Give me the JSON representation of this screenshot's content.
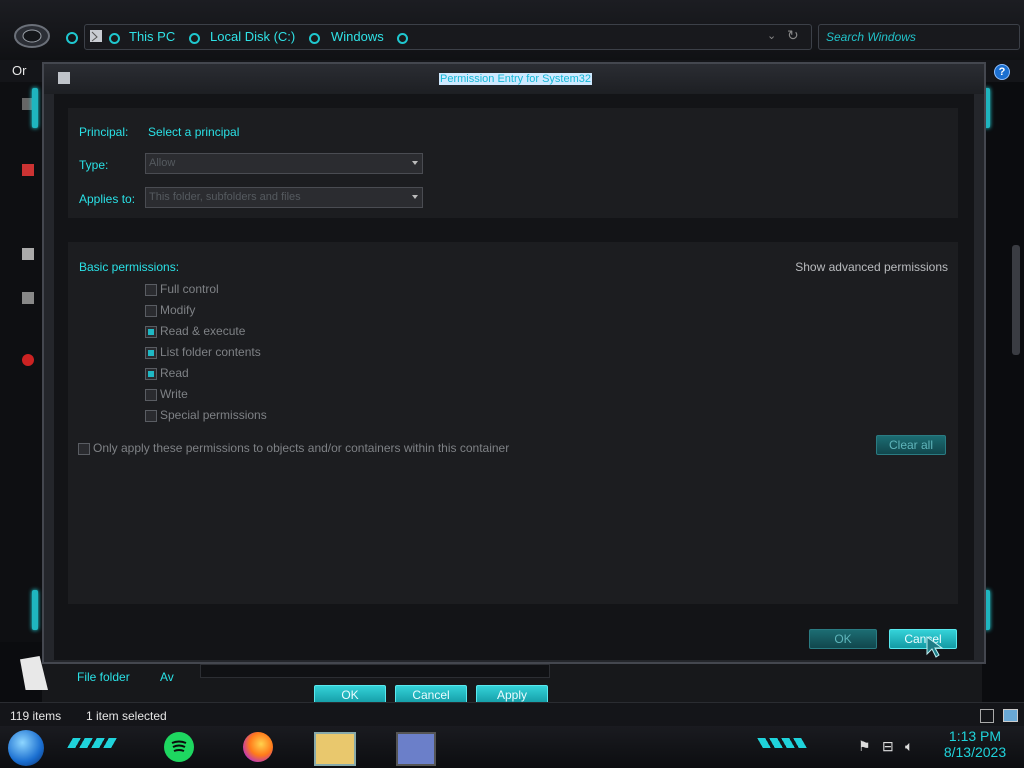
{
  "explorer": {
    "breadcrumbs": [
      "This PC",
      "Local Disk (C:)",
      "Windows"
    ],
    "search_placeholder": "Search Windows",
    "organize_label": "Or",
    "help_label": "?",
    "row_type": "File folder",
    "row_partial": "Av",
    "status_items": "119 items",
    "status_selected": "1 item selected",
    "buttons": {
      "ok": "OK",
      "cancel": "Cancel",
      "apply": "Apply"
    }
  },
  "dialog": {
    "title": "Permission Entry for System32",
    "principal_label": "Principal:",
    "principal_value": "Select a principal",
    "type_label": "Type:",
    "type_value": "Allow",
    "applies_label": "Applies to:",
    "applies_value": "This folder, subfolders and files",
    "basic_label": "Basic permissions:",
    "advanced_link": "Show advanced permissions",
    "permissions": [
      {
        "label": "Full control",
        "checked": false
      },
      {
        "label": "Modify",
        "checked": false
      },
      {
        "label": "Read & execute",
        "checked": true
      },
      {
        "label": "List folder contents",
        "checked": true
      },
      {
        "label": "Read",
        "checked": true
      },
      {
        "label": "Write",
        "checked": false
      },
      {
        "label": "Special permissions",
        "checked": false
      }
    ],
    "only_apply_label": "Only apply these permissions to objects and/or containers within this container",
    "clear_all": "Clear all",
    "ok": "OK",
    "cancel": "Cancel"
  },
  "taskbar": {
    "time": "1:13 PM",
    "date": "8/13/2023"
  },
  "colors": {
    "accent": "#1fd3db",
    "checked_fill": "#1fb8c4",
    "title_highlight": "#cfe9ff"
  }
}
